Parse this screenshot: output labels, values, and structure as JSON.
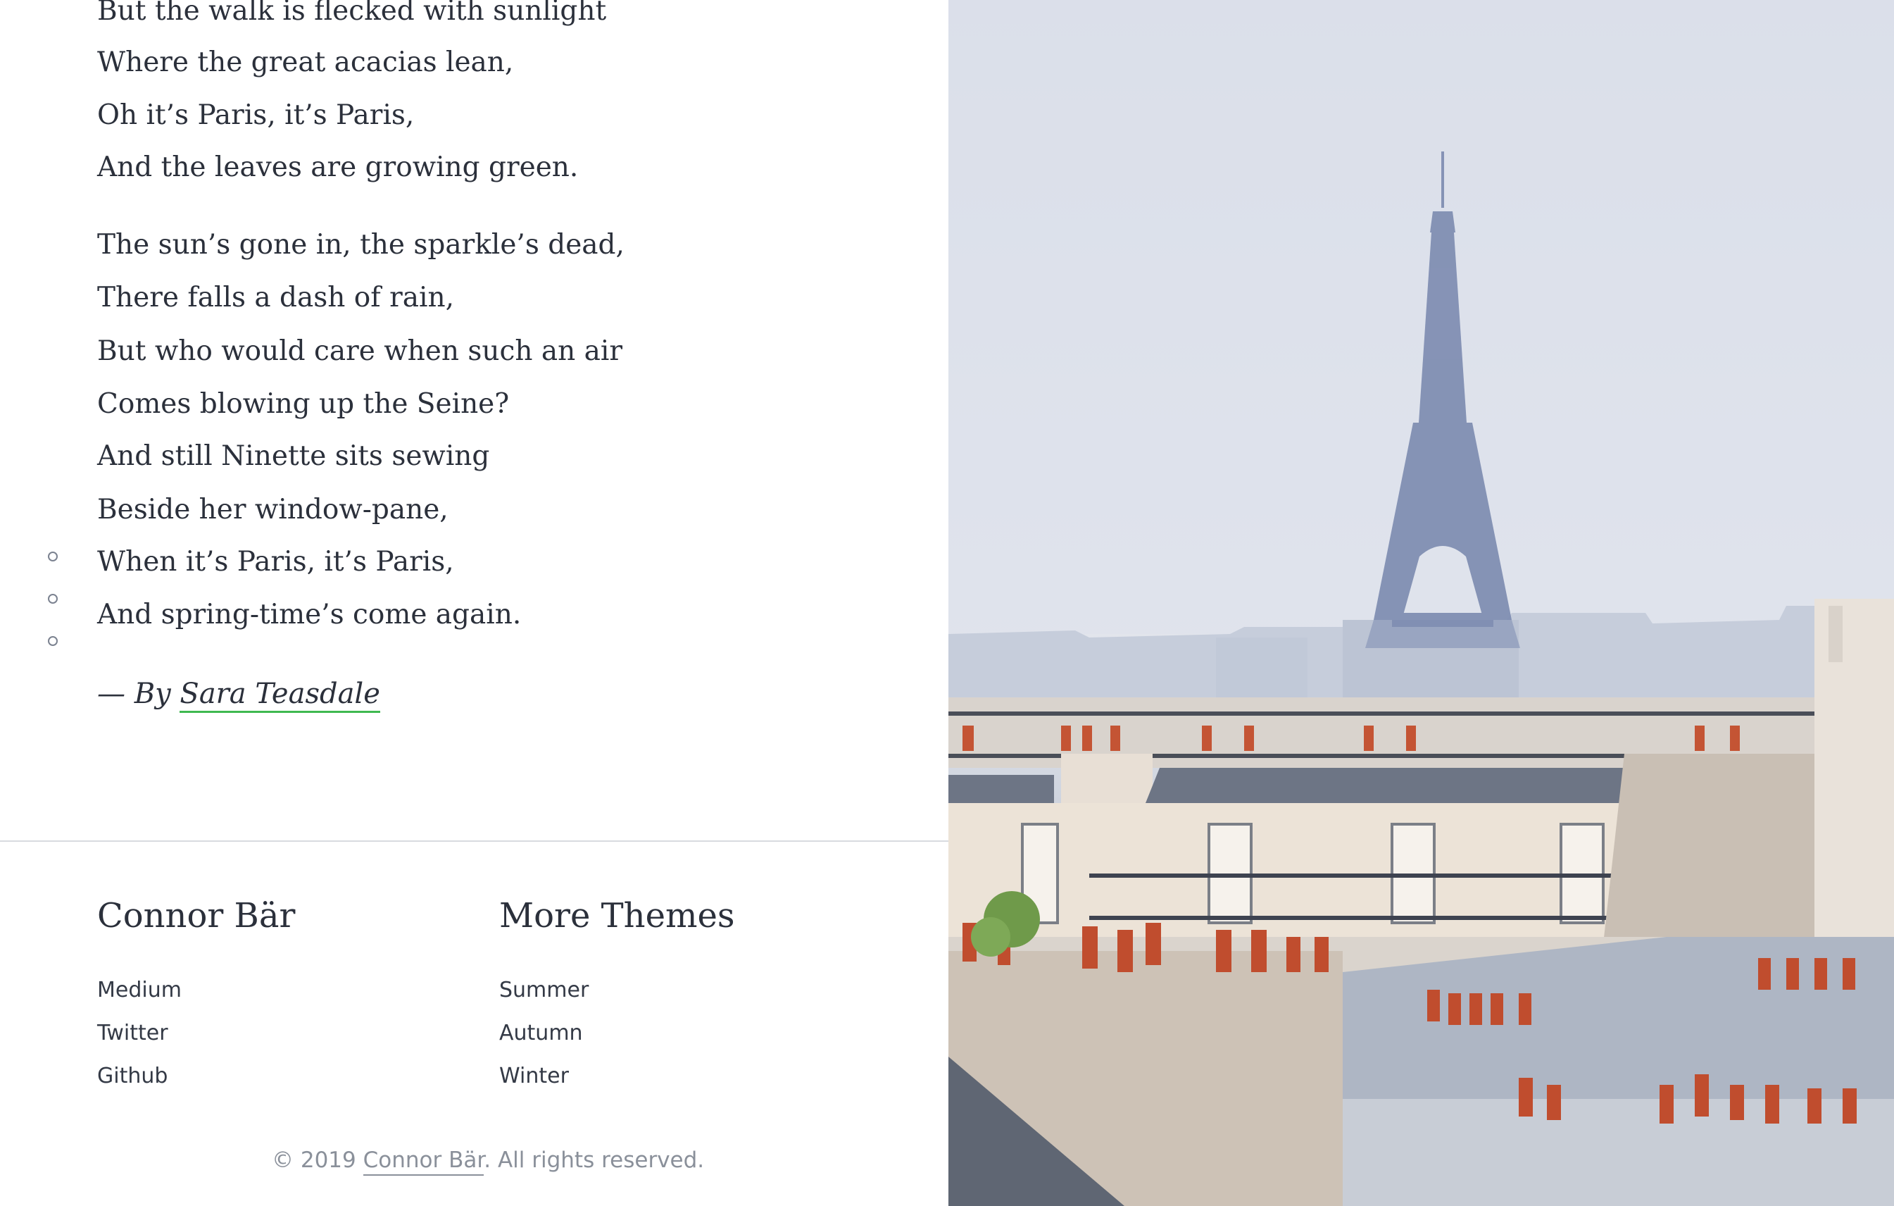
{
  "poem": {
    "lines": [
      "But the walk is flecked with sunlight",
      "Where the great acacias lean,",
      "Oh it’s Paris, it’s Paris,",
      "And the leaves are growing green.",
      "The sun’s gone in, the sparkle’s dead,",
      "There falls a dash of rain,",
      "But who would care when such an air",
      "Comes blowing up the Seine?",
      "And still Ninette sits sewing",
      "Beside her window-pane,",
      "When it’s Paris, it’s Paris,",
      "And spring-time’s come again."
    ],
    "attribution_prefix": "— By ",
    "author": "Sara Teasdale"
  },
  "footer": {
    "col1": {
      "heading": "Connor Bär",
      "links": [
        "Medium",
        "Twitter",
        "Github"
      ]
    },
    "col2": {
      "heading": "More Themes",
      "links": [
        "Summer",
        "Autumn",
        "Winter"
      ]
    },
    "copyright_prefix": "© 2019 ",
    "copyright_author": "Connor Bär",
    "copyright_suffix": ". All rights reserved."
  },
  "colors": {
    "accent_underline": "#3fb950",
    "text": "#2b303b",
    "muted": "#8a909a"
  }
}
